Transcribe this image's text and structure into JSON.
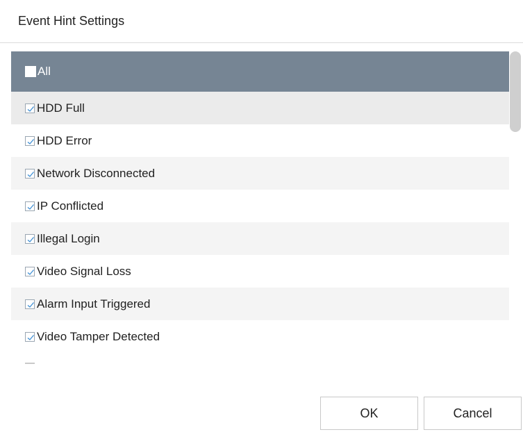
{
  "dialog": {
    "title": "Event Hint Settings"
  },
  "list": {
    "header": {
      "label": "All",
      "checked": false
    },
    "items": [
      {
        "label": "HDD Full",
        "checked": true
      },
      {
        "label": "HDD Error",
        "checked": true
      },
      {
        "label": "Network Disconnected",
        "checked": true
      },
      {
        "label": "IP Conflicted",
        "checked": true
      },
      {
        "label": "Illegal Login",
        "checked": true
      },
      {
        "label": "Video Signal Loss",
        "checked": true
      },
      {
        "label": "Alarm Input Triggered",
        "checked": true
      },
      {
        "label": "Video Tamper Detected",
        "checked": true
      }
    ]
  },
  "buttons": {
    "ok_label": "OK",
    "cancel_label": "Cancel"
  },
  "colors": {
    "header_bg": "#768594",
    "checkbox_border": "#9aa6b2",
    "checkmark": "#3d8fd6",
    "scroll_thumb": "#cfcfcf"
  }
}
